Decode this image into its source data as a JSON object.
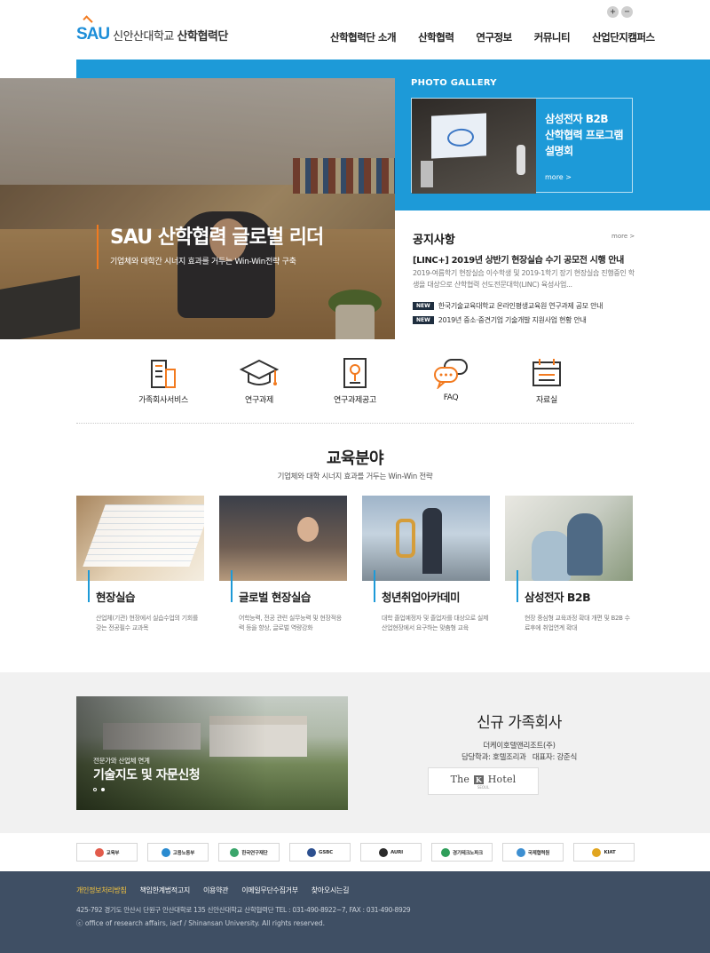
{
  "header": {
    "zoom_in": "+",
    "zoom_out": "−",
    "logo_mark": "SAU",
    "logo_university": "신안산대학교",
    "logo_org": "산학협력단",
    "nav": [
      "산학협력단 소개",
      "산학협력",
      "연구정보",
      "커뮤니티",
      "산업단지캠퍼스"
    ]
  },
  "hero": {
    "title": "SAU 산학협력 글로벌 리더",
    "subtitle": "기업체와 대학간 시너지 효과를 거두는 Win-Win전략 구축"
  },
  "gallery": {
    "heading": "PHOTO GALLERY",
    "caption_lines": [
      "삼성전자 B2B",
      "산학협력 프로그램",
      "설명회"
    ],
    "more": "more  >"
  },
  "notice": {
    "heading": "공지사항",
    "more": "more  >",
    "headline": "[LINC+] 2019년 상반기 현장실습 수기 공모전 시행 안내",
    "description": "2019-여름학기 현장실습 이수학생 및 2019-1학기 장기 현장실습 진행중인 학생을 대상으로 산학협력 선도전문대학(LINC) 육성사업...",
    "items": [
      {
        "badge": "NEW",
        "text": "한국기술교육대학교 온라인평생교육원 연구과제 공모 안내"
      },
      {
        "badge": "NEW",
        "text": "2019년 중소·중견기업 기술개발 지원사업 현황 안내"
      }
    ]
  },
  "quick_menu": [
    {
      "label": "가족회사서비스",
      "icon": "building-icon"
    },
    {
      "label": "연구과제",
      "icon": "graduation-cap-icon"
    },
    {
      "label": "연구과제공고",
      "icon": "certificate-icon"
    },
    {
      "label": "FAQ",
      "icon": "chat-bubbles-icon"
    },
    {
      "label": "자료실",
      "icon": "calendar-icon"
    }
  ],
  "education": {
    "title": "교육분야",
    "subtitle": "기업체와 대학 시너지 효과를 거두는 Win-Win 전략",
    "cards": [
      {
        "name": "현장실습",
        "desc": "산업체(기관) 현장에서 실습수업의 기회를 갖는 전공필수 교과목"
      },
      {
        "name": "글로벌 현장실습",
        "desc": "어학능력, 전공 관련 실무능력 및 현장적응력 등을 향상, 글로벌 역량강화"
      },
      {
        "name": "청년취업아카데미",
        "desc": "대학 졸업예정자 및 졸업자를 대상으로 실제 산업현장에서 요구하는 맞춤형 교육"
      },
      {
        "name": "삼성전자 B2B",
        "desc": "현장 중심형 교육과정 확대 개편 및 B2B 수료후에 취업연계 확대"
      }
    ]
  },
  "consulting": {
    "small": "전문가와 산업체 연계",
    "big": "기술지도 및 자문신청"
  },
  "family": {
    "title": "신규 가족회사",
    "company": "더케이호텔앤리조트(주)",
    "dept_label": "담당학과: 호텔조리과",
    "ceo_label": "대표자: 강준식",
    "logo_left": "The",
    "logo_k": "K",
    "logo_right": "Hotel",
    "logo_sub": "SEOUL"
  },
  "partners": [
    {
      "name": "교육부",
      "color": "#e25b4b"
    },
    {
      "name": "고용노동부",
      "color": "#2a8bd0"
    },
    {
      "name": "한국연구재단",
      "color": "#3aa56b"
    },
    {
      "name": "GSBC",
      "color": "#2c4f8f"
    },
    {
      "name": "AURI",
      "color": "#2b2b2b"
    },
    {
      "name": "경기테크노파크",
      "color": "#2f9e5a"
    },
    {
      "name": "국제협력원",
      "color": "#3d8fd1"
    },
    {
      "name": "KIAT",
      "color": "#e1a51f"
    }
  ],
  "footer": {
    "links": [
      "개인정보처리방침",
      "책임한계법적고지",
      "이용약관",
      "이메일무단수집거부",
      "찾아오시는길"
    ],
    "address": "425-792 경기도 안산시 단원구 안산대학로 135 신안산대학교 산학협력단   TEL : 031-490-8922~7, FAX : 031-490-8929",
    "copyright": "ⓒ office of research affairs, iacf / Shinansan University. All rights reserved."
  }
}
